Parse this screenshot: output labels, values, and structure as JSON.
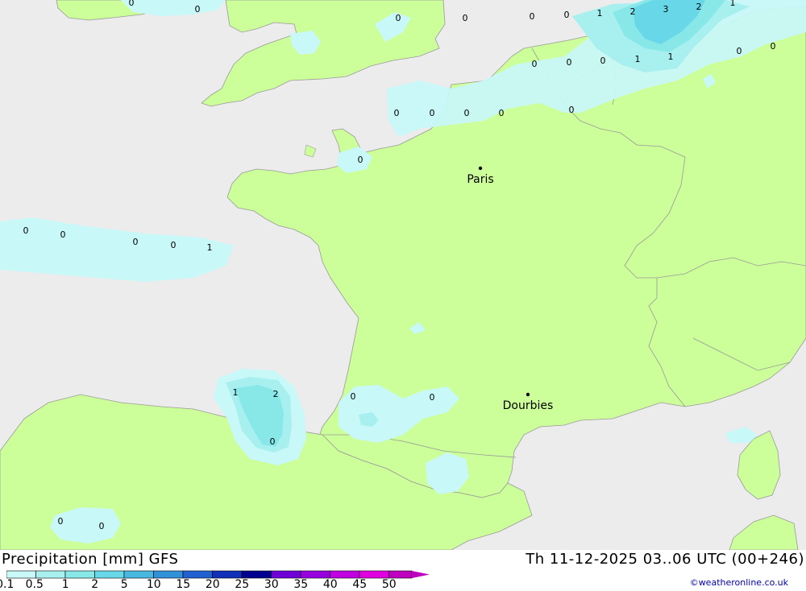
{
  "header": {
    "title": "Precipitation [mm] GFS",
    "timestamp": "Th 11-12-2025 03..06 UTC (00+246)"
  },
  "credit": "©weatheronline.co.uk",
  "colors": {
    "sea": "#ececec",
    "land": "#ccff99",
    "border": "#999999"
  },
  "legend": {
    "ticks": [
      "0.1",
      "0.5",
      "1",
      "2",
      "5",
      "10",
      "15",
      "20",
      "25",
      "30",
      "35",
      "40",
      "45",
      "50"
    ],
    "colors": [
      "#c8f8f8",
      "#a8f0f0",
      "#88e8e8",
      "#68d8e8",
      "#48b8e0",
      "#3090d8",
      "#2060d0",
      "#1030b8",
      "#000090",
      "#7000d8",
      "#9800e0",
      "#c000e0",
      "#e000e0",
      "#c000c0"
    ]
  },
  "cities": [
    {
      "name": "Paris"
    },
    {
      "name": "Dourbies"
    }
  ],
  "value_labels": [
    "0",
    "0",
    "0",
    "0",
    "0",
    "0",
    "1",
    "2",
    "3",
    "2",
    "1",
    "0",
    "0",
    "1",
    "1",
    "0",
    "0",
    "0",
    "0",
    "0",
    "0",
    "0",
    "0",
    "0",
    "0",
    "0",
    "0",
    "0",
    "1",
    "1",
    "2",
    "0",
    "0",
    "0",
    "0",
    "0"
  ]
}
